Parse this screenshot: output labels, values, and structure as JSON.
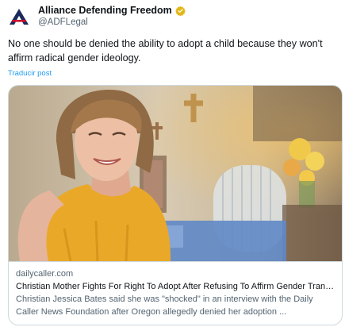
{
  "author": {
    "name": "Alliance Defending Freedom",
    "handle": "@ADFLegal",
    "avatar_icon": "adf-logo-icon",
    "verified_icon": "verified-badge-icon",
    "verified_color": "#e2b719"
  },
  "tweet": {
    "text": "No one should be denied the ability to adopt a child because they won't affirm radical gender ideology.",
    "translate_label": "Traducir post"
  },
  "card": {
    "image_alt": "Photo of a smiling woman in a yellow top",
    "domain": "dailycaller.com",
    "title": "Christian Mother Fights For Right To Adopt After Refusing To Affirm Gender Transition For Potential Foster Children",
    "description": "Christian Jessica Bates said she was \"shocked\" in an interview with the Daily Caller News Foundation after Oregon allegedly denied her adoption ..."
  },
  "colors": {
    "link": "#1d9bf0",
    "secondary_text": "#536471",
    "border": "#cfd9de"
  }
}
